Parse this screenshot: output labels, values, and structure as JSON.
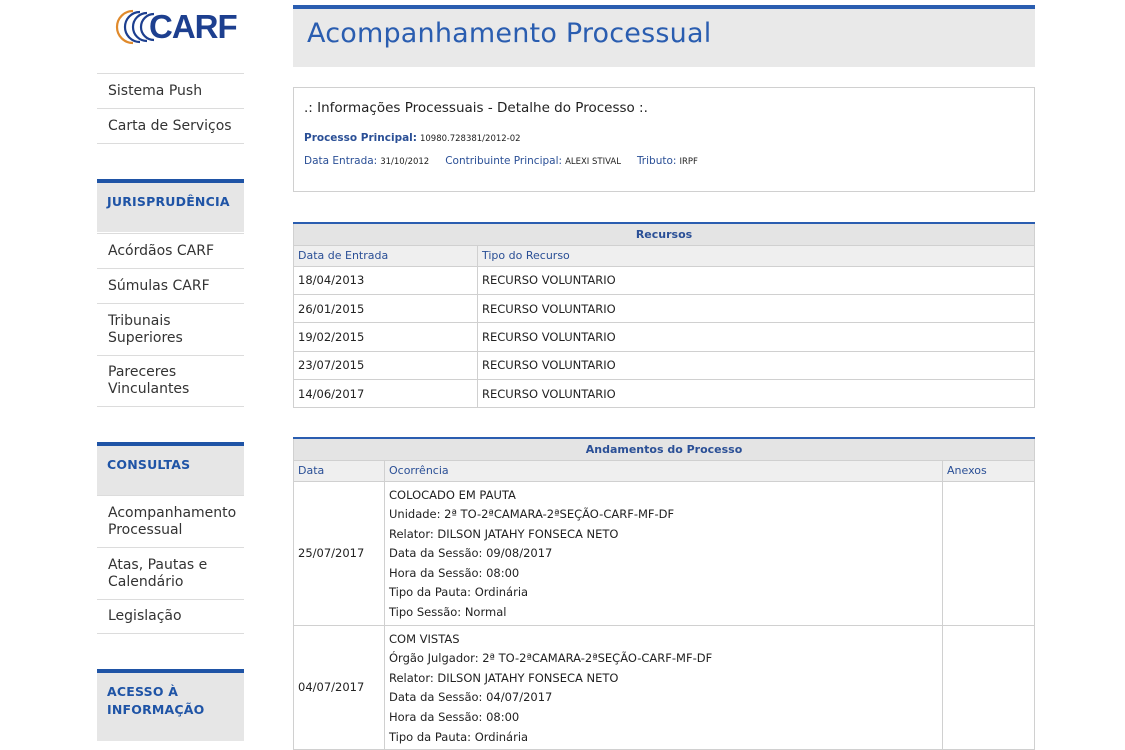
{
  "logo": {
    "text": "CARF"
  },
  "sidebar": {
    "top_links": [
      {
        "label": "Sistema Push"
      },
      {
        "label": "Carta de Serviços"
      }
    ],
    "sections": [
      {
        "title": "JURISPRUDÊNCIA",
        "links": [
          {
            "label": "Acórdãos CARF"
          },
          {
            "label": "Súmulas CARF"
          },
          {
            "label": "Tribunais Superiores"
          },
          {
            "label": "Pareceres Vinculantes"
          }
        ]
      },
      {
        "title": "CONSULTAS",
        "links": [
          {
            "label": "Acompanhamento Processual"
          },
          {
            "label": "Atas, Pautas e Calendário"
          },
          {
            "label": "Legislação"
          }
        ]
      },
      {
        "title": "ACESSO À INFORMAÇÃO",
        "links": []
      }
    ]
  },
  "page": {
    "title": "Acompanhamento Processual"
  },
  "info": {
    "heading": ".: Informações Processuais - Detalhe do Processo :.",
    "processo_label": "Processo Principal:",
    "processo_value": "10980.728381/2012-02",
    "data_label": "Data Entrada:",
    "data_value": "31/10/2012",
    "contribuinte_label": "Contribuinte Principal:",
    "contribuinte_value": "ALEXI STIVAL",
    "tributo_label": "Tributo:",
    "tributo_value": "IRPF"
  },
  "recursos": {
    "caption": "Recursos",
    "headers": [
      "Data de Entrada",
      "Tipo do Recurso"
    ],
    "rows": [
      [
        "18/04/2013",
        "RECURSO VOLUNTARIO"
      ],
      [
        "26/01/2015",
        "RECURSO VOLUNTARIO"
      ],
      [
        "19/02/2015",
        "RECURSO VOLUNTARIO"
      ],
      [
        "23/07/2015",
        "RECURSO VOLUNTARIO"
      ],
      [
        "14/06/2017",
        "RECURSO VOLUNTARIO"
      ]
    ]
  },
  "andamentos": {
    "caption": "Andamentos do Processo",
    "headers": [
      "Data",
      "Ocorrência",
      "Anexos"
    ],
    "rows": [
      {
        "date": "25/07/2017",
        "lines": [
          "COLOCADO EM PAUTA",
          "Unidade: 2ª TO-2ªCAMARA-2ªSEÇÃO-CARF-MF-DF",
          "Relator: DILSON JATAHY FONSECA NETO",
          "Data da Sessão: 09/08/2017",
          "Hora da Sessão: 08:00",
          "Tipo da Pauta: Ordinária",
          "Tipo Sessão: Normal"
        ],
        "anexos": ""
      },
      {
        "date": "04/07/2017",
        "lines": [
          "COM VISTAS",
          "Órgão Julgador: 2ª TO-2ªCAMARA-2ªSEÇÃO-CARF-MF-DF",
          "Relator: DILSON JATAHY FONSECA NETO",
          "Data da Sessão: 04/07/2017",
          "Hora da Sessão: 08:00",
          "Tipo da Pauta: Ordinária"
        ],
        "anexos": ""
      }
    ]
  }
}
